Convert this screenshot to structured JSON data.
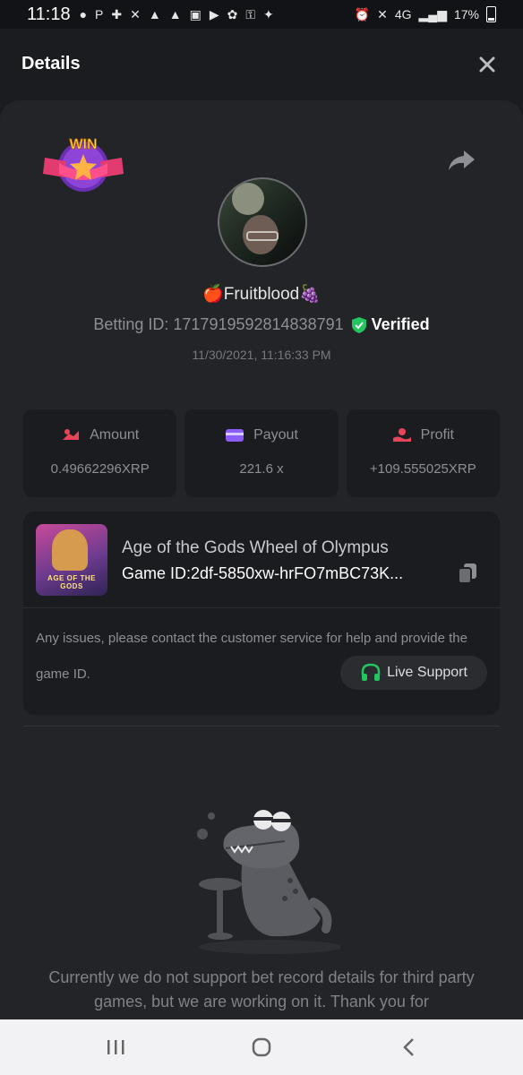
{
  "status_bar": {
    "time": "11:18",
    "battery_pct": "17%",
    "left_icons": [
      "reddit-icon",
      "paypal-icon",
      "game-icon",
      "missed-call-icon",
      "notification-icon",
      "notification-icon",
      "image-icon",
      "app-icon",
      "settings-icon",
      "vpn-key-icon",
      "shield-icon"
    ],
    "right_icons": [
      "alarm-icon",
      "mute-icon",
      "4g-lte-icon",
      "signal-icon"
    ]
  },
  "header": {
    "title": "Details"
  },
  "win_badge": {
    "text": "WIN"
  },
  "user": {
    "name": "🍎Fruitblood🍇",
    "betting_label": "Betting ID: 1717919592814838791",
    "verified": "Verified",
    "date": "11/30/2021, 11:16:33 PM"
  },
  "stats": [
    {
      "label": "Amount",
      "value": "0.49662296XRP",
      "icon": "amount-icon",
      "color": "#e8455a"
    },
    {
      "label": "Payout",
      "value": "221.6 x",
      "icon": "card-icon",
      "color": "#8b5cf6"
    },
    {
      "label": "Profit",
      "value": "+109.555025XRP",
      "icon": "profit-icon",
      "color": "#e8455a"
    }
  ],
  "game": {
    "name": "Age of the Gods Wheel of Olympus",
    "id_label": "Game ID:",
    "id_value": "2df-5850xw-hrFO7mBC73K...",
    "thumb_text": "AGE OF THE GODS"
  },
  "support": {
    "message": "Any issues, please contact the customer service for help and provide the game ID.",
    "button": "Live Support"
  },
  "notice": "Currently we do not support bet record details for third party games, but we are working on it. Thank you for",
  "colors": {
    "accent_green": "#22c55e",
    "background": "#1b1c1f",
    "panel": "#232427"
  }
}
